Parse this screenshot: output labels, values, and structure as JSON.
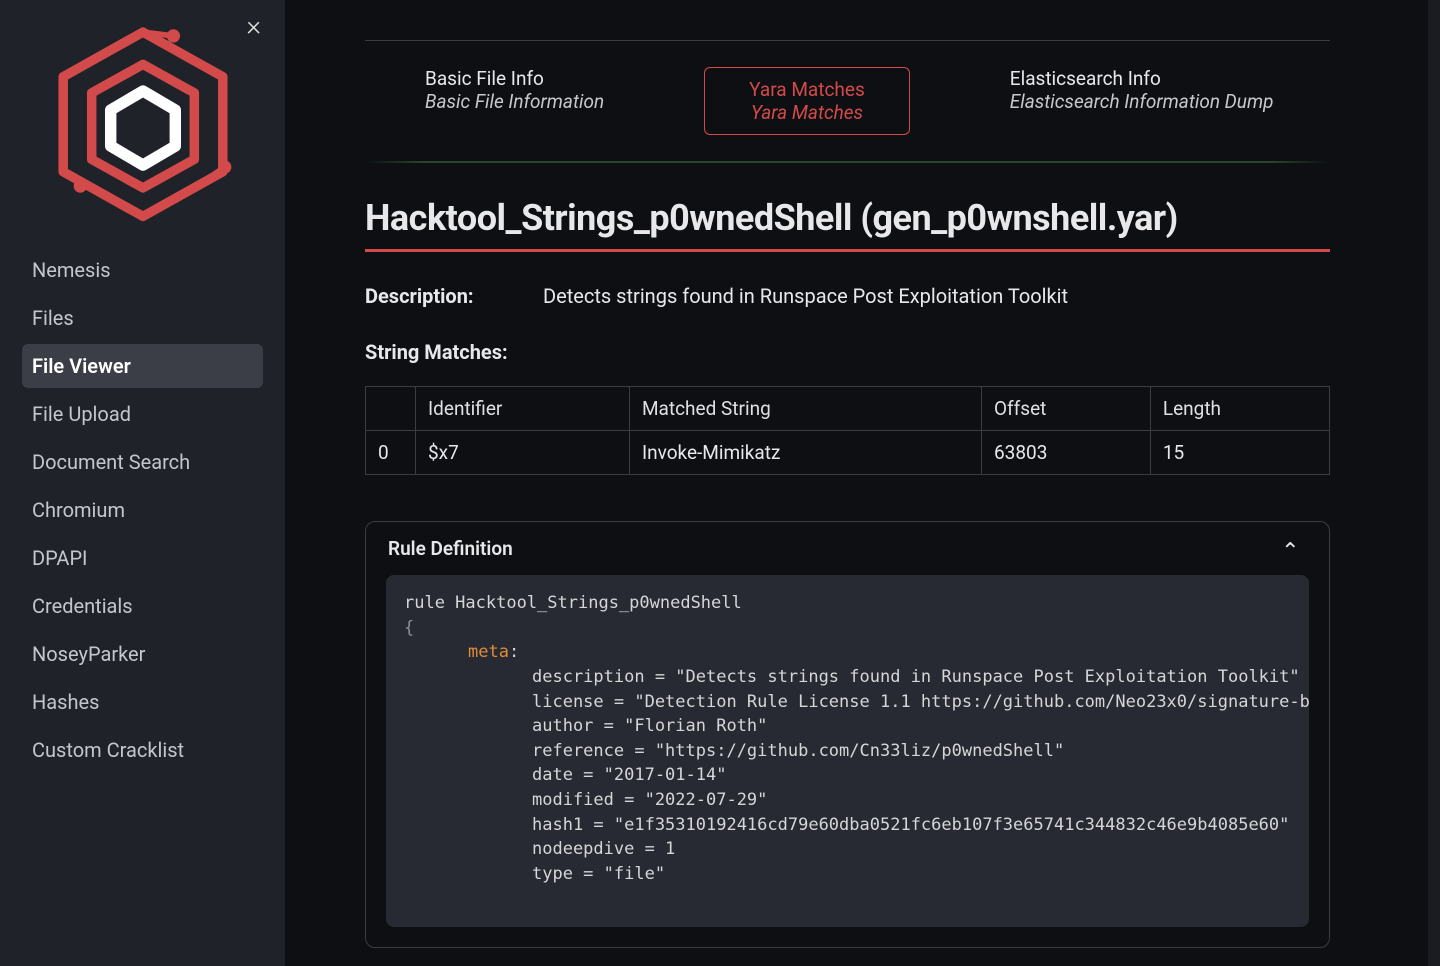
{
  "sidebar": {
    "items": [
      {
        "label": "Nemesis"
      },
      {
        "label": "Files"
      },
      {
        "label": "File Viewer"
      },
      {
        "label": "File Upload"
      },
      {
        "label": "Document Search"
      },
      {
        "label": "Chromium"
      },
      {
        "label": "DPAPI"
      },
      {
        "label": "Credentials"
      },
      {
        "label": "NoseyParker"
      },
      {
        "label": "Hashes"
      },
      {
        "label": "Custom Cracklist"
      }
    ],
    "active_index": 2
  },
  "tabs": {
    "basic": {
      "title": "Basic File Info",
      "subtitle": "Basic File Information"
    },
    "yara": {
      "title": "Yara Matches",
      "subtitle": "Yara Matches"
    },
    "es": {
      "title": "Elasticsearch Info",
      "subtitle": "Elasticsearch Information Dump"
    }
  },
  "title": "Hacktool_Strings_p0wnedShell (gen_p0wnshell.yar)",
  "description": {
    "label": "Description:",
    "value": "Detects strings found in Runspace Post Exploitation Toolkit"
  },
  "string_matches_label": "String Matches:",
  "table": {
    "headers": {
      "identifier": "Identifier",
      "matched": "Matched String",
      "offset": "Offset",
      "length": "Length"
    },
    "rows": [
      {
        "index": "0",
        "identifier": "$x7",
        "matched": "Invoke-Mimikatz",
        "offset": "63803",
        "length": "15"
      }
    ]
  },
  "rule_panel": {
    "title": "Rule Definition",
    "code": {
      "rule_decl": "rule Hacktool_Strings_p0wnedShell",
      "brace_open": "{",
      "meta_kw": "meta",
      "colon": ":",
      "lines": [
        "description = \"Detects strings found in Runspace Post Exploitation Toolkit\"",
        "license = \"Detection Rule License 1.1 https://github.com/Neo23x0/signature-b",
        "author = \"Florian Roth\"",
        "reference = \"https://github.com/Cn33liz/p0wnedShell\"",
        "date = \"2017-01-14\"",
        "modified = \"2022-07-29\"",
        "hash1 = \"e1f35310192416cd79e60dba0521fc6eb107f3e65741c344832c46e9b4085e60\"",
        "nodeepdive = 1",
        "type = \"file\""
      ]
    }
  }
}
